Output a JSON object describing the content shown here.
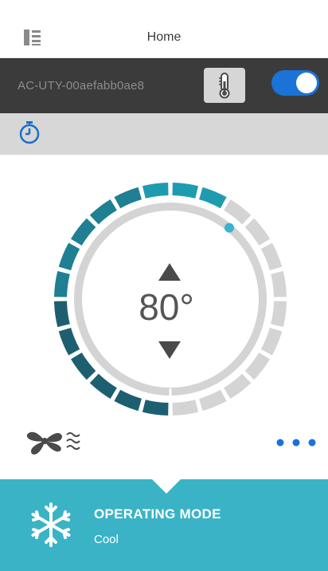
{
  "header": {
    "title": "Home",
    "menu_icon": "menu-panel-icon"
  },
  "device": {
    "name": "AC-UTY-00aefabb0ae8",
    "thermostat_icon": "thermometer-icon",
    "power_on": true,
    "toggle_color": "#1a73d6"
  },
  "timer": {
    "icon": "timer-icon"
  },
  "thermostat": {
    "temperature": "80°",
    "setpoint_fraction": 0.61,
    "up_icon": "triangle-up-icon",
    "down_icon": "triangle-down-icon",
    "active_color": "#1f9bb0",
    "inactive_color": "#d4d4d4"
  },
  "controls": {
    "fan_icon": "fan-speed-icon",
    "more_icon": "more-dots-icon"
  },
  "operating_mode": {
    "label": "OPERATING MODE",
    "value": "Cool",
    "icon": "snowflake-icon",
    "bar_color": "#3ab3c6"
  }
}
